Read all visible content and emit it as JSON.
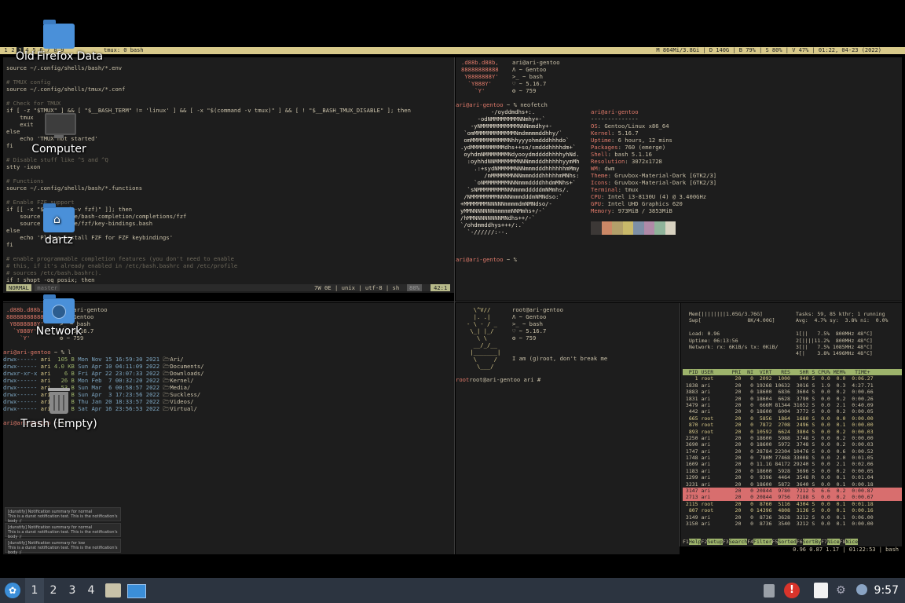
{
  "tmux": {
    "windows": [
      "1",
      "2",
      "3",
      "4",
      "5",
      "6",
      "7",
      "8",
      "9"
    ],
    "active_window": "3",
    "title": "tmux: 0 bash",
    "status": "M 864Mi/3.8Gi | D 140G | B 79% | S 80% | V 47% | 01:22, 04-23 (2022)"
  },
  "desktop": {
    "icons": [
      {
        "label": "Firefox Data",
        "overlay": "Old"
      },
      {
        "label": "Computer"
      },
      {
        "label": "dartz"
      },
      {
        "label": "Network"
      },
      {
        "label": "Trash (Empty)"
      }
    ]
  },
  "vim": {
    "lines": [
      "source ~/.config/shells/bash/*.env",
      "",
      "# TMUX config",
      "source ~/.config/shells/tmux/*.conf",
      "",
      "# Check for TMUX",
      "if [ -z \"$TMUX\" ] && [ \"$__BASH_TERM\" != 'linux' ] && [ -x \"$(command -v tmux)\" ] && [ ! \"$__BASH_TMUX_DISABLE\" ]; then",
      "    tmux",
      "    exit",
      "else",
      "    echo 'TMUX not started'",
      "fi",
      "",
      "# Disable stuff like ^S and ^Q",
      "stty -ixon",
      "",
      "# Functions",
      "source ~/.config/shells/bash/*.functions",
      "",
      "# Enable FZF support",
      "if [[ -x \"$(command -v fzf)\" ]]; then",
      "    source /usr/share/bash-completion/completions/fzf",
      "    source /usr/share/fzf/key-bindings.bash",
      "else",
      "    echo 'Please install FZF for FZF keybindings'",
      "fi",
      "",
      "# enable programmable completion features (you don't need to enable",
      "# this, if it's already enabled in /etc/bash.bashrc and /etc/profile",
      "# sources /etc/bash.bashrc).",
      "if ! shopt -oq posix; then"
    ],
    "line_number": "42",
    "mode": "NORMAL",
    "branch": "master",
    "fileinfo": "7W 0E | unix | utf-8 | sh",
    "percent": "80%",
    "position": "42:1"
  },
  "logo_small": [
    ".d88b.d88b,",
    "88888888888",
    " Y8888888Y'",
    "  `Y888Y'",
    "    `Y'"
  ],
  "info_small": [
    "ari@ari-gentoo",
    "Λ ~ Gentoo",
    ">_ ~ bash",
    "♡ ~ 5.16.7",
    "⚙ ~ 759"
  ],
  "neofetch": {
    "prompt": "ari@ari-gentoo ~ % neofetch",
    "user": "ari@ari-gentoo",
    "divider": "--------------",
    "fields": [
      {
        "k": "OS",
        "v": "Gentoo/Linux x86_64"
      },
      {
        "k": "Kernel",
        "v": "5.16.7"
      },
      {
        "k": "Uptime",
        "v": "6 hours, 12 mins"
      },
      {
        "k": "Packages",
        "v": "760 (emerge)"
      },
      {
        "k": "Shell",
        "v": "bash 5.1.16"
      },
      {
        "k": "Resolution",
        "v": "3072x1728"
      },
      {
        "k": "WM",
        "v": "dwm"
      },
      {
        "k": "Theme",
        "v": "Gruvbox-Material-Dark [GTK2/3]"
      },
      {
        "k": "Icons",
        "v": "Gruvbox-Material-Dark [GTK2/3]"
      },
      {
        "k": "Terminal",
        "v": "tmux"
      },
      {
        "k": "CPU",
        "v": "Intel i3-8130U (4) @ 3.400GHz"
      },
      {
        "k": "GPU",
        "v": "Intel UHD Graphics 620"
      },
      {
        "k": "Memory",
        "v": "973MiB / 3853MiB"
      }
    ],
    "art": [
      "         -/oyddmdhs+:.",
      "     -odNMMMMMMMMNNmhy+-`",
      "   -yNMMMMMMMMMMMNNNmmdhy+-",
      " `omMMMMMMMMMMMMNmdmmmmddhhy/`",
      " omMMMMMMMMMMMNhhyyyohmdddhhhdo`",
      ".ydMMMMMMMMMMdhs++so/smdddhhhhdm+`",
      " oyhdmNMMMMMMMNdyooydmddddhhhhyhNd.",
      "  :oyhhdNNMMMMMMMNNNmmdddhhhhhyymMh",
      "    .:+sydNMMMMMNNNmmmdddhhhhhhmMmy",
      "       /mMMMMMMNNNmmmdddhhhhhmMNhs:",
      "    `oNMMMMMMMNNNmmmddddhhdmMNhs+`",
      "  `sNMMMMMMMMNNNmmmdddddmNMmhs/.",
      " /NMMMMMMMMNNNNmmmdddmNMNdso:`",
      "+MMMMMMMNNNNNmmmmdmNMNdso/-",
      "yMMNNNNNNNmmmmmNNMmhs+/-`",
      "/hMMNNNNNNNNMNdhs++/-`",
      "`/ohdmmddhys+++/:.`",
      "  `-//////:--."
    ],
    "palette": [
      "#3c3836",
      "#cc8866",
      "#b3a06a",
      "#c9b96a",
      "#7d8fa6",
      "#b08aa8",
      "#8fb39a",
      "#d8d2c0"
    ],
    "prompt_end": "ari@ari-gentoo ~ %"
  },
  "ls": {
    "prompt": "ari@ari-gentoo ~ % l",
    "rows": [
      {
        "perm": "drwx------",
        "user": "ari",
        "size": "105 B",
        "date": "Mon Nov 15 16:59:30 2021",
        "name": "Ari/"
      },
      {
        "perm": "drwx------",
        "user": "ari",
        "size": "4.0 KB",
        "date": "Sun Apr 10 04:11:09 2022",
        "name": "Documents/"
      },
      {
        "perm": "drwxr-xr-x",
        "user": "ari",
        "size": "6 B",
        "date": "Fri Apr 22 23:07:33 2022",
        "name": "Downloads/"
      },
      {
        "perm": "drwx------",
        "user": "ari",
        "size": "26 B",
        "date": "Mon Feb  7 00:32:20 2022",
        "name": "Kernel/"
      },
      {
        "perm": "drwx------",
        "user": "ari",
        "size": "53 B",
        "date": "Sun Mar  6 00:58:57 2022",
        "name": "Media/"
      },
      {
        "perm": "drwx------",
        "user": "ari",
        "size": "62 B",
        "date": "Sun Apr  3 17:23:56 2022",
        "name": "Suckless/"
      },
      {
        "perm": "drwx------",
        "user": "ari",
        "size": "53 B",
        "date": "Thu Jan 20 18:33:57 2022",
        "name": "Videos/"
      },
      {
        "perm": "drwx------",
        "user": "ari",
        "size": "6 B",
        "date": "Sat Apr 16 23:56:53 2022",
        "name": "Virtual/"
      }
    ],
    "prompt_end": "ari@ari-gentoo ~ %"
  },
  "notifications": [
    {
      "title": "[dunstify] Notification summary for normal",
      "body": "This is a dunst notification test. This is the notification's body :/"
    },
    {
      "title": "[dunstify] Notification summary for normal",
      "body": "This is a dunst notification test. This is the notification's body :/"
    },
    {
      "title": "[dunstify] Notification summary for low",
      "body": "This is a dunst notification test. This is the notification's body :/"
    }
  ],
  "root": {
    "art": [
      "  \\^V//",
      "  |. .|",
      "- \\ - / _",
      " \\_| |_/",
      "   \\ \\",
      "  __/_/__",
      " |_______|",
      "  \\     /",
      "   \\___/"
    ],
    "info": [
      "root@ari-gentoo",
      "Λ ~ Gentoo",
      ">_ ~ bash",
      "♡ ~ 5.16.7",
      "⚙ ~ 759"
    ],
    "message": "I am (g)root, don't break me",
    "prompt": "root@ari-gentoo ari #"
  },
  "htop": {
    "meters_left": [
      "Mem[||||||||1.05G/3.76G]",
      "Swp[               8K/4.00G]",
      "",
      "Load: 0.96",
      "Uptime: 06:13:56",
      "Network: rx: 6KiB/s tx: 0KiB/"
    ],
    "meters_right": [
      "Tasks: 59, 85 kthr; 1 running",
      "Avg:  4.7% sy:  3.8% ni:  0.0%",
      "",
      "1[||   7.5%  800MHz 48°C]",
      "2[||||11.2%  800MHz 48°C]",
      "3[||   7.5% 1085MHz 48°C]",
      "4[|    3.8% 1496MHz 48°C]"
    ],
    "header": "  PID USER      PRI  NI  VIRT   RES   SHR S CPU% MEM%   TIME+",
    "rows": [
      "    1 root       20   0  2092  1000   940 S  0.0  0.0  0:06.27",
      " 1838 ari        20   0 19268 10632  3016 S  1.9  0.3  4:27.71",
      " 3883 ari        20   0 18600  6836  3604 S  0.0  0.2  0:00.66",
      " 1831 ari        20   0 18604  6628  3790 S  0.0  0.2  0:00.26",
      " 3479 ari        20   0  666M 81344 31652 S  0.0  2.1  0:40.09",
      "  442 ari        20   0 18600  6004  3772 S  0.0  0.2  0:00.05",
      "  665 root       20   0  5856  1864  1680 S  0.0  0.0  0:00.00",
      "  870 root       20   0  7872  2708  2496 S  0.0  0.1  0:00.00",
      "  893 root       20   0 10592  6624  3804 S  0.0  0.2  0:00.03",
      " 2250 ari        20   0 18600  5988  3748 S  0.0  0.2  0:00.00",
      " 3690 ari        20   0 18600  5972  3748 S  0.0  0.2  0:00.03",
      " 1747 ari        20   0 28784 22304 10476 S  0.0  0.6  0:00.52",
      " 1748 ari        20   0  780M 77468 33008 S  0.0  2.0  0:01.05",
      " 1609 ari        20   0 11.1G 84172 29240 S  0.0  2.1  0:02.06",
      " 1183 ari        20   0 18600  5928  3696 S  0.0  0.2  0:00.05",
      " 1299 ari        20   0  9396  4464  3548 R  0.0  0.1  0:01.04",
      " 3231 ari        20   0 18600  5872  3640 S  0.0  0.1  0:00.18",
      " 3147 ari        20   0 20844  9780  7212 S  6.6  0.2  0:00.87",
      " 2713 ari        20   0 20844  9756  7188 S  0.0  0.2  0:00.67",
      " 2115 root       20   0  8760  5116  4304 S  0.0  0.1  0:01.18",
      "  807 root       20   0 14396  4808  3136 S  0.0  0.1  0:00.16",
      " 3149 ari        20   0  8736  3628  3212 S  0.0  0.1  0:06.00",
      " 3150 ari        20   0  8736  3540  3212 S  0.0  0.1  0:00.00"
    ],
    "selected": [
      17,
      18
    ],
    "footer": [
      {
        "key": "F1",
        "label": "Help"
      },
      {
        "key": "F2",
        "label": "Setup"
      },
      {
        "key": "F3",
        "label": "Search"
      },
      {
        "key": "F4",
        "label": "Filter"
      },
      {
        "key": "F5",
        "label": "Sorted"
      },
      {
        "key": "F6",
        "label": "SortBy"
      },
      {
        "key": "F7",
        "label": "Nice"
      },
      {
        "key": "F8",
        "label": "Nice"
      }
    ]
  },
  "tmux_bottom": "0.96 0.87 1.17 | 01:22:53 | bash",
  "taskbar": {
    "workspaces": [
      "1",
      "2",
      "3",
      "4"
    ],
    "active": "1",
    "clock": "9:57"
  }
}
